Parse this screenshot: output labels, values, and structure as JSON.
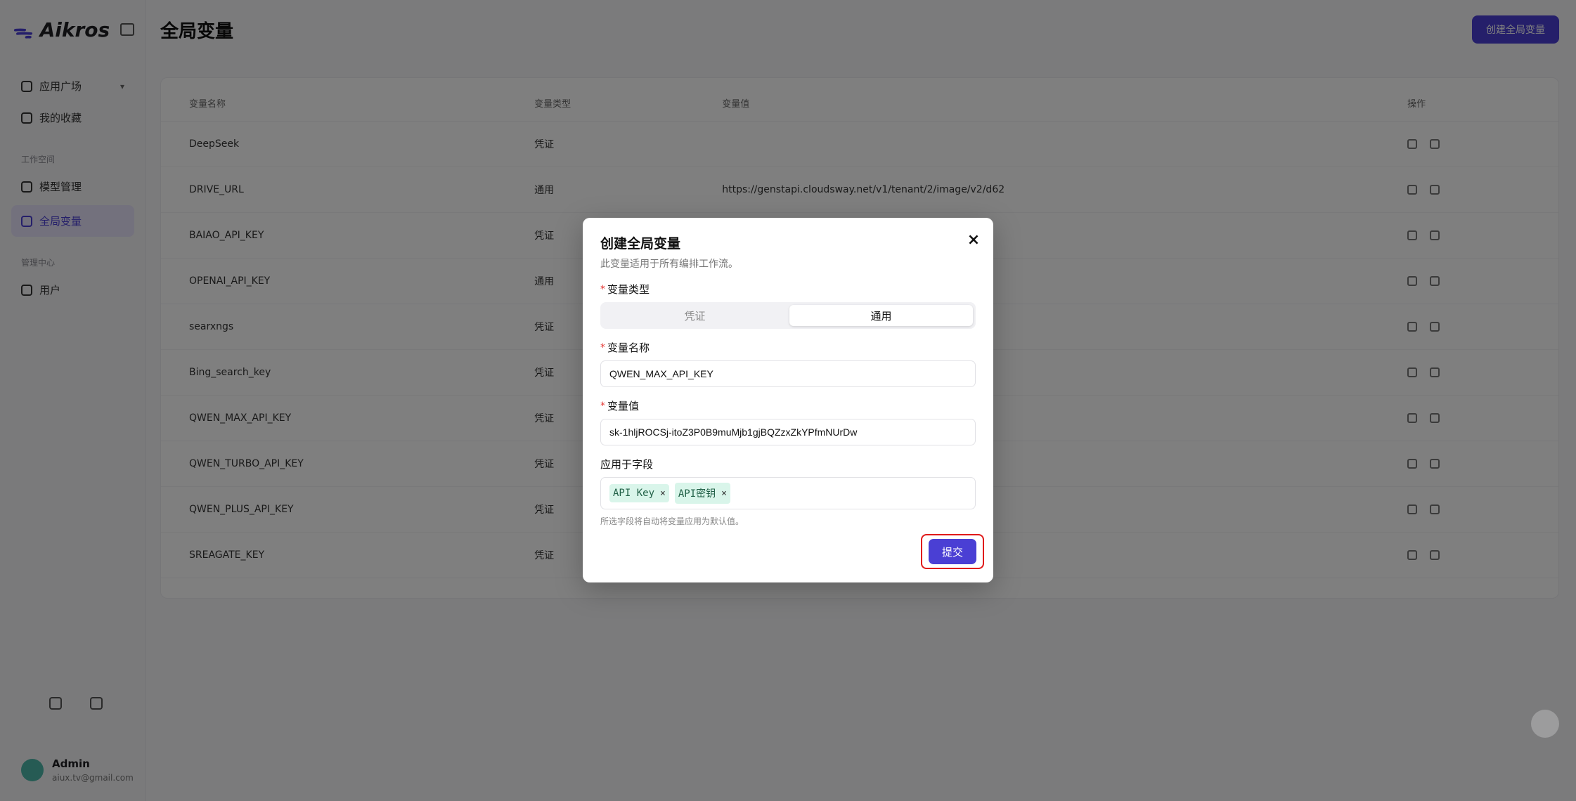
{
  "sidebar": {
    "brand": "Aikros",
    "workspace": "应用广场",
    "items": [
      {
        "label": "我的收藏",
        "active": false
      },
      {
        "label": "模型管理",
        "active": false
      },
      {
        "label": "全局变量",
        "active": true
      },
      {
        "label": "用户",
        "active": false
      }
    ],
    "sections": [
      "工作空间",
      "管理中心"
    ],
    "user": {
      "name": "Admin",
      "email": "aiux.tv@gmail.com"
    }
  },
  "main": {
    "title": "全局变量",
    "create_button": "创建全局变量",
    "table": {
      "headers": [
        "变量名称",
        "变量类型",
        "变量值",
        "操作"
      ],
      "rows": [
        {
          "name": "DeepSeek",
          "type": "凭证",
          "value": ""
        },
        {
          "name": "DRIVE_URL",
          "type": "通用",
          "value": "https://genstapi.cloudsway.net/v1/tenant/2/image/v2/d62"
        },
        {
          "name": "BAIAO_API_KEY",
          "type": "凭证",
          "value": ""
        },
        {
          "name": "OPENAI_API_KEY",
          "type": "通用",
          "value": ""
        },
        {
          "name": "searxngs",
          "type": "凭证",
          "value": ""
        },
        {
          "name": "Bing_search_key",
          "type": "凭证",
          "value": ""
        },
        {
          "name": "QWEN_MAX_API_KEY",
          "type": "凭证",
          "value": ""
        },
        {
          "name": "QWEN_TURBO_API_KEY",
          "type": "凭证",
          "value": ""
        },
        {
          "name": "QWEN_PLUS_API_KEY",
          "type": "凭证",
          "value": ""
        },
        {
          "name": "SREAGATE_KEY",
          "type": "凭证",
          "value": ""
        }
      ]
    }
  },
  "dialog": {
    "title": "创建全局变量",
    "description": "此变量适用于所有编排工作流。",
    "close_icon": "×",
    "type_label": "变量类型",
    "type_options": [
      "凭证",
      "通用"
    ],
    "type_selected": "通用",
    "name_label": "变量名称",
    "name_value": "QWEN_MAX_API_KEY",
    "value_label": "变量值",
    "value_value": "sk-1hljROCSj-itoZ3P0B9muMjb1gjBQZzxZkYPfmNUrDw",
    "fields_label": "应用于字段",
    "fields_tags": [
      "API Key",
      "API密钥"
    ],
    "tag_remove": "×",
    "fields_help": "所选字段将自动将变量应用为默认值。",
    "submit_label": "提交",
    "required_mark": "*"
  },
  "colors": {
    "accent": "#4a3fd4",
    "highlight_border": "#e01919",
    "tag_bg": "#d9f5ea",
    "required": "#e53935"
  }
}
